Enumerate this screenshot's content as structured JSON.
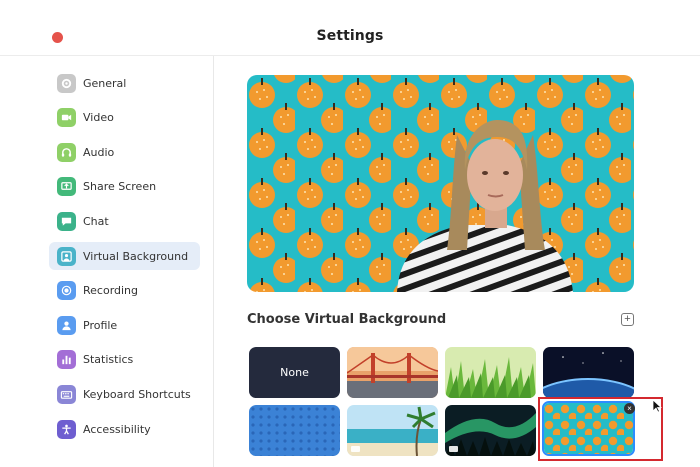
{
  "window": {
    "title": "Settings"
  },
  "sidebar": {
    "items": [
      {
        "label": "General",
        "icon": "gear-icon",
        "color": "#c8c8c8"
      },
      {
        "label": "Video",
        "icon": "video-camera-icon",
        "color": "#8fd067"
      },
      {
        "label": "Audio",
        "icon": "headphones-icon",
        "color": "#8fd067"
      },
      {
        "label": "Share Screen",
        "icon": "share-screen-icon",
        "color": "#43b97a"
      },
      {
        "label": "Chat",
        "icon": "chat-bubble-icon",
        "color": "#3bb28a"
      },
      {
        "label": "Virtual Background",
        "icon": "person-background-icon",
        "color": "#4ab3c9",
        "active": true
      },
      {
        "label": "Recording",
        "icon": "record-icon",
        "color": "#5a9cf0"
      },
      {
        "label": "Profile",
        "icon": "person-icon",
        "color": "#5a9cf0"
      },
      {
        "label": "Statistics",
        "icon": "bar-chart-icon",
        "color": "#a36ed6"
      },
      {
        "label": "Keyboard Shortcuts",
        "icon": "keyboard-icon",
        "color": "#8a86d6"
      },
      {
        "label": "Accessibility",
        "icon": "accessibility-icon",
        "color": "#6e5ed0"
      }
    ]
  },
  "main": {
    "section_title": "Choose Virtual Background",
    "add_icon": "plus-icon",
    "backgrounds": [
      {
        "label": "None",
        "kind": "none"
      },
      {
        "kind": "golden-gate-bridge"
      },
      {
        "kind": "grass"
      },
      {
        "kind": "earth-from-space"
      },
      {
        "kind": "blue-pattern"
      },
      {
        "kind": "beach",
        "video": true
      },
      {
        "kind": "aurora",
        "video": true
      },
      {
        "kind": "orange-pattern",
        "selected": true
      }
    ]
  },
  "colors": {
    "accent": "#2d8cff",
    "highlight": "#d4292f",
    "active_nav": "#e5edf8"
  }
}
